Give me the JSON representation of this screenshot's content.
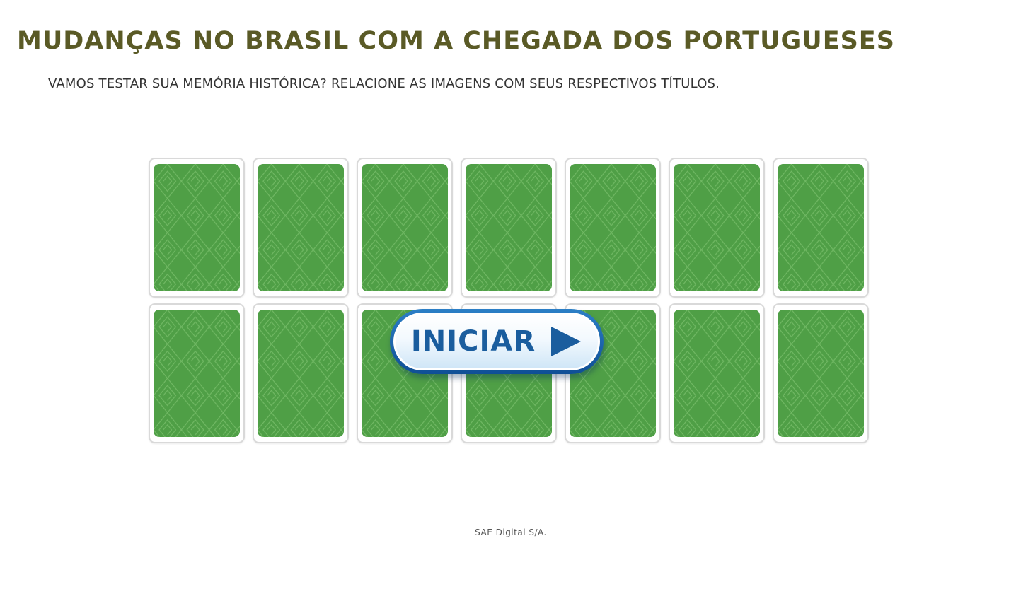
{
  "title": "MUDANÇAS NO BRASIL COM A CHEGADA DOS PORTUGUESES",
  "instructions": "VAMOS TESTAR SUA MEMÓRIA HISTÓRICA? RELACIONE AS IMAGENS COM SEUS RESPECTIVOS TÍTULOS.",
  "game": {
    "rows": 2,
    "columns": 7,
    "card_state": "face-down",
    "card_back_color": "#4f9f46",
    "card_pattern_color": "#8fcf80",
    "start_button": {
      "label": "INICIAR",
      "icon": "play-arrow-icon"
    }
  },
  "footer": "SAE Digital S/A."
}
